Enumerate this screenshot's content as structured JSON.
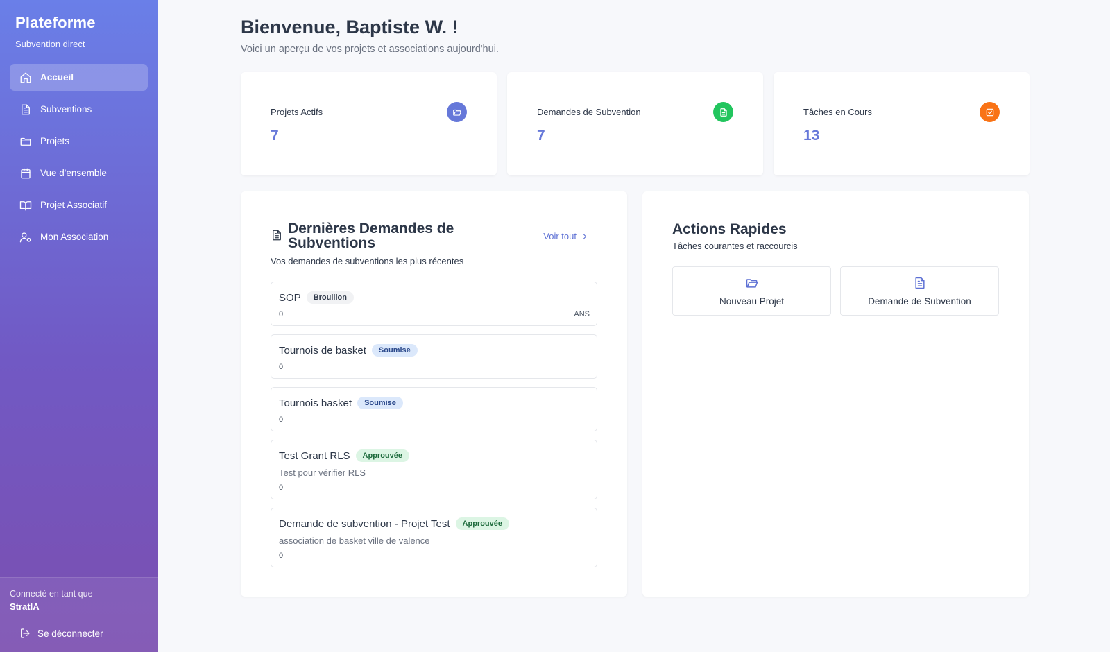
{
  "sidebar": {
    "brand_title": "Plateforme",
    "brand_subtitle": "Subvention direct",
    "items": [
      {
        "label": "Accueil",
        "icon": "home-icon",
        "active": true
      },
      {
        "label": "Subventions",
        "icon": "file-text-icon"
      },
      {
        "label": "Projets",
        "icon": "folder-icon"
      },
      {
        "label": "Vue d'ensemble",
        "icon": "calendar-icon"
      },
      {
        "label": "Projet Associatif",
        "icon": "book-open-icon"
      },
      {
        "label": "Mon Association",
        "icon": "user-cog-icon"
      }
    ],
    "connected_label": "Connecté en tant que",
    "connected_user": "StratIA",
    "logout_label": "Se déconnecter"
  },
  "header": {
    "title": "Bienvenue, Baptiste W. !",
    "subtitle": "Voici un aperçu de vos projets et associations aujourd'hui."
  },
  "stats": [
    {
      "label": "Projets Actifs",
      "value": "7",
      "icon": "folder-open-icon",
      "color": "#6678d9"
    },
    {
      "label": "Demandes de Subvention",
      "value": "7",
      "icon": "file-text-icon",
      "color": "#22c55e"
    },
    {
      "label": "Tâches en Cours",
      "value": "13",
      "icon": "check-square-icon",
      "color": "#f97316"
    }
  ],
  "requests_panel": {
    "title": "Dernières Demandes de Subventions",
    "subtitle": "Vos demandes de subventions les plus récentes",
    "see_all": "Voir tout",
    "items": [
      {
        "title": "SOP",
        "status": "Brouillon",
        "status_kind": "draft",
        "description": "",
        "amount": "0",
        "tag": "ANS"
      },
      {
        "title": "Tournois de basket",
        "status": "Soumise",
        "status_kind": "submitted",
        "description": "",
        "amount": "0",
        "tag": ""
      },
      {
        "title": "Tournois basket",
        "status": "Soumise",
        "status_kind": "submitted",
        "description": "",
        "amount": "0",
        "tag": ""
      },
      {
        "title": "Test Grant RLS",
        "status": "Approuvée",
        "status_kind": "approved",
        "description": "Test pour vérifier RLS",
        "amount": "0",
        "tag": ""
      },
      {
        "title": "Demande de subvention - Projet Test",
        "status": "Approuvée",
        "status_kind": "approved",
        "description": "association de basket ville de valence",
        "amount": "0",
        "tag": ""
      }
    ]
  },
  "quick_actions": {
    "title": "Actions Rapides",
    "subtitle": "Tâches courantes et raccourcis",
    "actions": [
      {
        "label": "Nouveau Projet",
        "icon": "folder-open-icon"
      },
      {
        "label": "Demande de Subvention",
        "icon": "file-text-icon"
      }
    ]
  },
  "colors": {
    "accent": "#5d70d4",
    "sidebar_top": "#6a7fe8",
    "sidebar_bottom": "#7b4fb0"
  }
}
